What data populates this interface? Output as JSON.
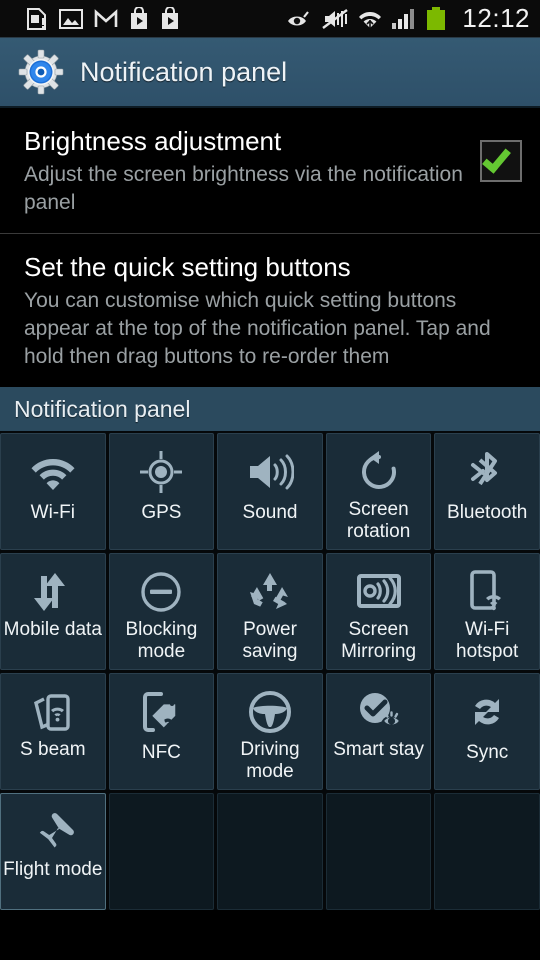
{
  "statusbar": {
    "time": "12:12",
    "left_icons": [
      "sim-card-alert-icon",
      "gallery-image-icon",
      "gmail-icon",
      "play-store-icon",
      "play-store-icon-2"
    ],
    "right_icons": [
      "smart-stay-eye-icon",
      "sound-mute-vibrate-off-icon",
      "wifi-signal-icon",
      "cellular-signal-icon",
      "battery-full-icon"
    ]
  },
  "actionbar": {
    "icon": "settings-gear-icon",
    "title": "Notification panel"
  },
  "preferences": [
    {
      "title": "Brightness adjustment",
      "summary": "Adjust the screen brightness via the notification panel",
      "checked": true
    },
    {
      "title": "Set the quick setting buttons",
      "summary": "You can customise which quick setting buttons appear at the top of the notification panel. Tap and hold then drag buttons to re-order them",
      "checked": false
    }
  ],
  "grid_section": {
    "header": "Notification panel",
    "tiles": [
      {
        "label": "Wi-Fi",
        "icon": "wifi-icon",
        "empty": false
      },
      {
        "label": "GPS",
        "icon": "gps-crosshair-icon",
        "empty": false
      },
      {
        "label": "Sound",
        "icon": "speaker-sound-icon",
        "empty": false
      },
      {
        "label": "Screen rotation",
        "icon": "rotate-ccw-icon",
        "empty": false
      },
      {
        "label": "Bluetooth",
        "icon": "bluetooth-icon",
        "empty": false
      },
      {
        "label": "Mobile data",
        "icon": "data-arrows-icon",
        "empty": false
      },
      {
        "label": "Blocking mode",
        "icon": "minus-circle-icon",
        "empty": false
      },
      {
        "label": "Power saving",
        "icon": "recycle-leaf-icon",
        "empty": false
      },
      {
        "label": "Screen Mirroring",
        "icon": "screen-cast-icon",
        "empty": false
      },
      {
        "label": "Wi-Fi hotspot",
        "icon": "phone-hotspot-icon",
        "empty": false
      },
      {
        "label": "S beam",
        "icon": "s-beam-phones-icon",
        "empty": false
      },
      {
        "label": "NFC",
        "icon": "nfc-tag-icon",
        "empty": false
      },
      {
        "label": "Driving mode",
        "icon": "steering-wheel-icon",
        "empty": false
      },
      {
        "label": "Smart stay",
        "icon": "smart-stay-eye-icon",
        "empty": false
      },
      {
        "label": "Sync",
        "icon": "sync-arrows-icon",
        "empty": false
      },
      {
        "label": "Flight mode",
        "icon": "airplane-icon",
        "empty": false
      },
      {
        "label": "",
        "icon": "",
        "empty": true
      },
      {
        "label": "",
        "icon": "",
        "empty": true
      },
      {
        "label": "",
        "icon": "",
        "empty": true
      },
      {
        "label": "",
        "icon": "",
        "empty": true
      }
    ]
  },
  "colors": {
    "accent_blue": "#31566e",
    "section_header": "#2b4a5e",
    "tile_bg": "#1a2c38",
    "tile_empty_bg": "#0d1920",
    "check_green": "#64c832",
    "icon_gray": "#9fb3c0"
  }
}
